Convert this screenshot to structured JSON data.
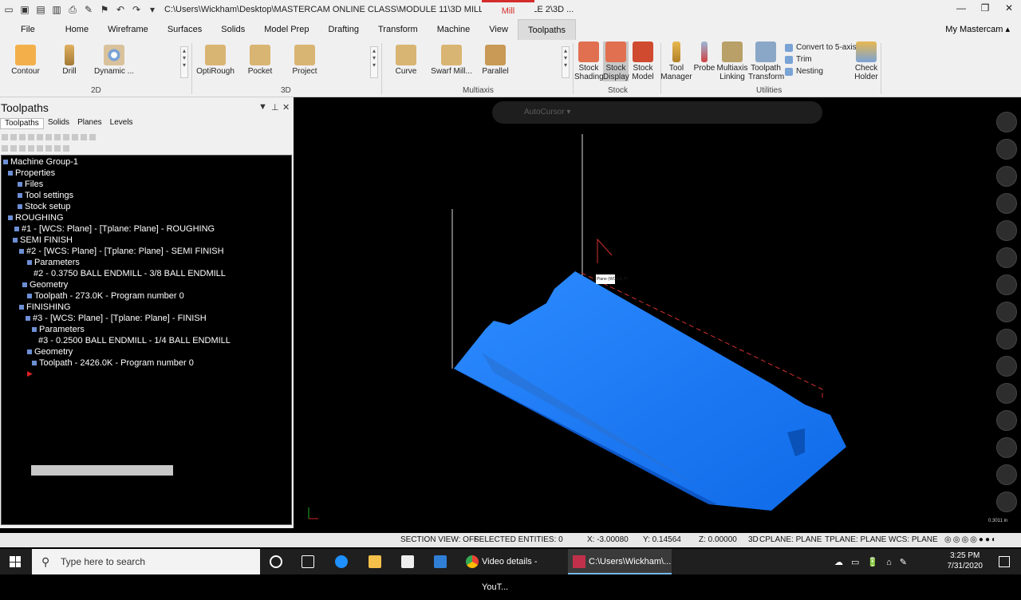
{
  "titlebar": {
    "path": "C:\\Users\\Wickham\\Desktop\\MASTERCAM ONLINE CLASS\\MODULE 11\\3D MILLING EXAMPLE 2\\3D ...",
    "context_tab": "Mill"
  },
  "menu": {
    "items": [
      "File",
      "Home",
      "Wireframe",
      "Surfaces",
      "Solids",
      "Model Prep",
      "Drafting",
      "Transform",
      "Machine",
      "View",
      "Toolpaths"
    ],
    "right": "My Mastercam"
  },
  "ribbon": {
    "groups": {
      "g2d": "2D",
      "g3d": "3D",
      "multiaxis": "Multiaxis",
      "stock": "Stock",
      "utilities": "Utilities"
    },
    "b2d": [
      "Contour",
      "Drill",
      "Dynamic ..."
    ],
    "b3d": [
      "OptiRough",
      "Pocket",
      "Project"
    ],
    "bmulti": [
      "Curve",
      "Swarf Mill...",
      "Parallel"
    ],
    "stock": [
      "Stock Shading",
      "Stock Display",
      "Stock Model"
    ],
    "utils": [
      "Tool Manager",
      "Probe",
      "Multiaxis Linking",
      "Toolpath Transform"
    ],
    "small": [
      "Convert to 5-axis",
      "Trim",
      "Nesting"
    ],
    "check": "Check Holder"
  },
  "panel": {
    "title": "Toolpaths",
    "tabs": [
      "Toolpaths",
      "Solids",
      "Planes",
      "Levels"
    ]
  },
  "tree": [
    "Machine Group-1",
    "Properties",
    "Files",
    "Tool settings",
    "Stock setup",
    "ROUGHING",
    "#1 - [WCS: Plane] - [Tplane: Plane] - ROUGHING",
    "SEMI FINISH",
    "#2 - [WCS: Plane] - [Tplane: Plane] - SEMI FINISH",
    "Parameters",
    "#2 - 0.3750 BALL ENDMILL - 3/8 BALL ENDMILL",
    "Geometry",
    "Toolpath - 273.0K - Program number 0",
    "FINISHING",
    "#3 - [WCS: Plane] - [Tplane: Plane] - FINISH",
    "Parameters",
    "#3 - 0.2500 BALL ENDMILL - 1/4 BALL ENDMILL",
    "Geometry",
    "Toolpath - 2426.0K - Program number 0"
  ],
  "viewport": {
    "autocursor": "AutoCursor",
    "plane_label": "Plane (WCS,C,T)",
    "scale": "0.3011 in"
  },
  "status": {
    "section_view": "SECTION VIEW: OFF",
    "selected": "SELECTED ENTITIES: 0",
    "x": "X:   -3.00080",
    "y": "Y:   0.14564",
    "z": "Z:  0.00000",
    "mode": "3D",
    "cplane": "CPLANE: PLANE",
    "tplane": "TPLANE: PLANE",
    "wcs": "WCS: PLANE"
  },
  "taskbar": {
    "search": "Type here to search",
    "chrome": "Video details - YouT...",
    "mastercam": "C:\\Users\\Wickham\\...",
    "time": "3:25 PM",
    "date": "7/31/2020"
  },
  "colors": {
    "part": "#1a7dff",
    "accent": "#d42c2c"
  }
}
